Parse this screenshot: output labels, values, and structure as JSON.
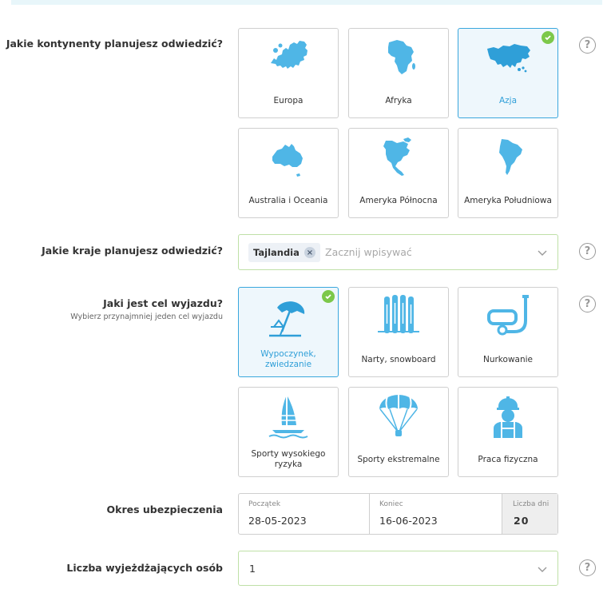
{
  "colors": {
    "accent": "#3aa7dd",
    "check": "#7cc84a",
    "field_border": "#bfe0a7"
  },
  "continents": {
    "label": "Jakie kontynenty planujesz odwiedzić?",
    "items": [
      {
        "label": "Europa",
        "icon": "europe-map-icon",
        "selected": false
      },
      {
        "label": "Afryka",
        "icon": "africa-map-icon",
        "selected": false
      },
      {
        "label": "Azja",
        "icon": "asia-map-icon",
        "selected": true
      },
      {
        "label": "Australia i Oceania",
        "icon": "australia-map-icon",
        "selected": false
      },
      {
        "label": "Ameryka Północna",
        "icon": "north-america-map-icon",
        "selected": false
      },
      {
        "label": "Ameryka Południowa",
        "icon": "south-america-map-icon",
        "selected": false
      }
    ]
  },
  "countries": {
    "label": "Jakie kraje planujesz odwiedzić?",
    "chip": "Tajlandia",
    "chip_remove": "×",
    "placeholder": "Zacznij wpisywać"
  },
  "purpose": {
    "label": "Jaki jest cel wyjazdu?",
    "sublabel": "Wybierz przynajmniej jeden cel wyjazdu",
    "items": [
      {
        "label": "Wypoczynek, zwiedzanie",
        "icon": "beach-umbrella-icon",
        "selected": true
      },
      {
        "label": "Narty, snowboard",
        "icon": "skis-icon",
        "selected": false
      },
      {
        "label": "Nurkowanie",
        "icon": "snorkel-mask-icon",
        "selected": false
      },
      {
        "label": "Sporty wysokiego ryzyka",
        "icon": "windsurf-icon",
        "selected": false
      },
      {
        "label": "Sporty ekstremalne",
        "icon": "parachute-icon",
        "selected": false
      },
      {
        "label": "Praca fizyczna",
        "icon": "worker-icon",
        "selected": false
      }
    ]
  },
  "period": {
    "label": "Okres ubezpieczenia",
    "start_caption": "Początek",
    "start_value": "28-05-2023",
    "end_caption": "Koniec",
    "end_value": "16-06-2023",
    "days_caption": "Liczba dni",
    "days_value": "20"
  },
  "travelers": {
    "label": "Liczba wyjeżdżających osób",
    "value": "1"
  },
  "help_symbol": "?"
}
